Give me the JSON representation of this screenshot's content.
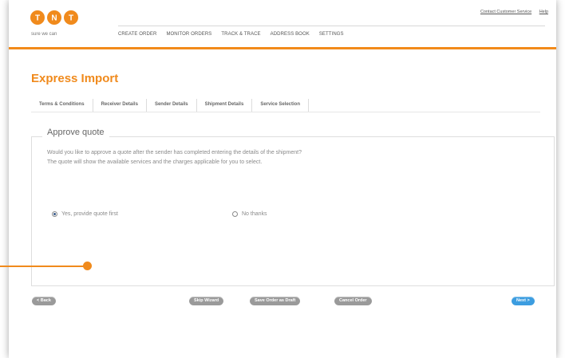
{
  "header": {
    "brand": "TNT",
    "slogan": "sure we can",
    "utility_links": [
      "Contact Customer Service",
      "Help"
    ],
    "nav": [
      "CREATE ORDER",
      "MONITOR ORDERS",
      "TRACK & TRACE",
      "ADDRESS BOOK",
      "SETTINGS"
    ]
  },
  "page": {
    "title": "Express Import"
  },
  "tabs": [
    "Terms & Conditions",
    "Receiver Details",
    "Sender Details",
    "Shipment Details",
    "Service Selection"
  ],
  "section": {
    "legend": "Approve quote",
    "line1": "Would you like to approve a quote after the sender has completed entering the details of the shipment?",
    "line2": "The quote will show the available services and the charges applicable for you to select."
  },
  "options": [
    {
      "label": "Yes, provide quote first",
      "selected": true
    },
    {
      "label": "No thanks",
      "selected": false
    }
  ],
  "buttons": {
    "back": "< Back",
    "skip": "Skip Wizard",
    "save_draft": "Save Order as Draft",
    "cancel": "Cancel Order",
    "next": "Next >"
  },
  "colors": {
    "accent": "#f08a1c",
    "primary_button": "#3c9de0",
    "secondary_button": "#9a9a9a"
  }
}
